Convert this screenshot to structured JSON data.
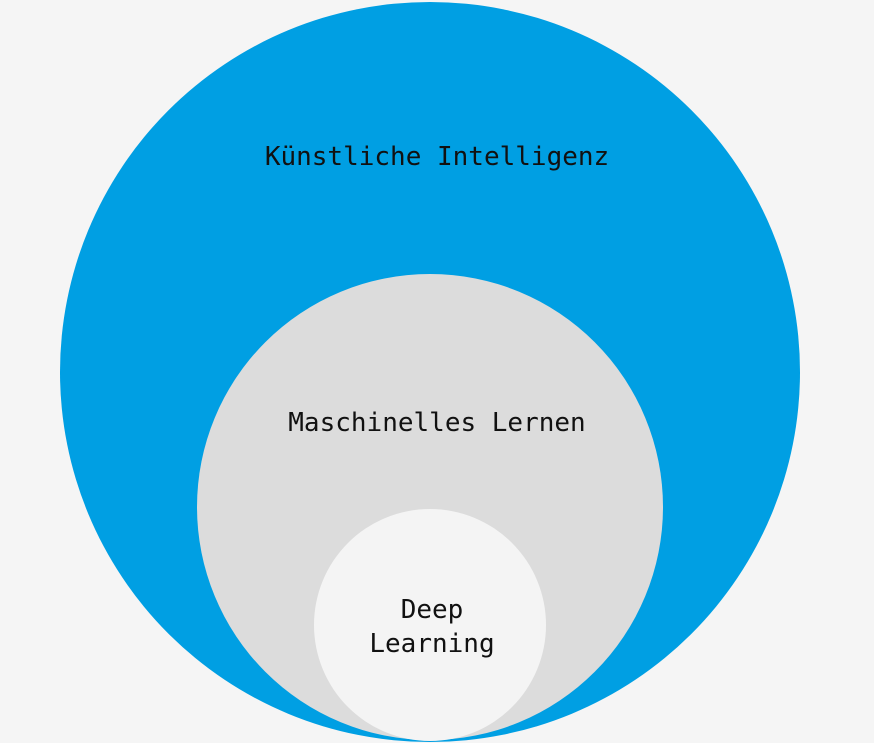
{
  "diagram": {
    "outer": {
      "label": "Künstliche Intelligenz",
      "color": "#009fe3"
    },
    "middle": {
      "label": "Maschinelles Lernen",
      "color": "#dcdcdc"
    },
    "inner": {
      "label_line1": "Deep",
      "label_line2": "Learning",
      "color": "#f4f4f4"
    },
    "background_color": "#f5f5f5"
  }
}
